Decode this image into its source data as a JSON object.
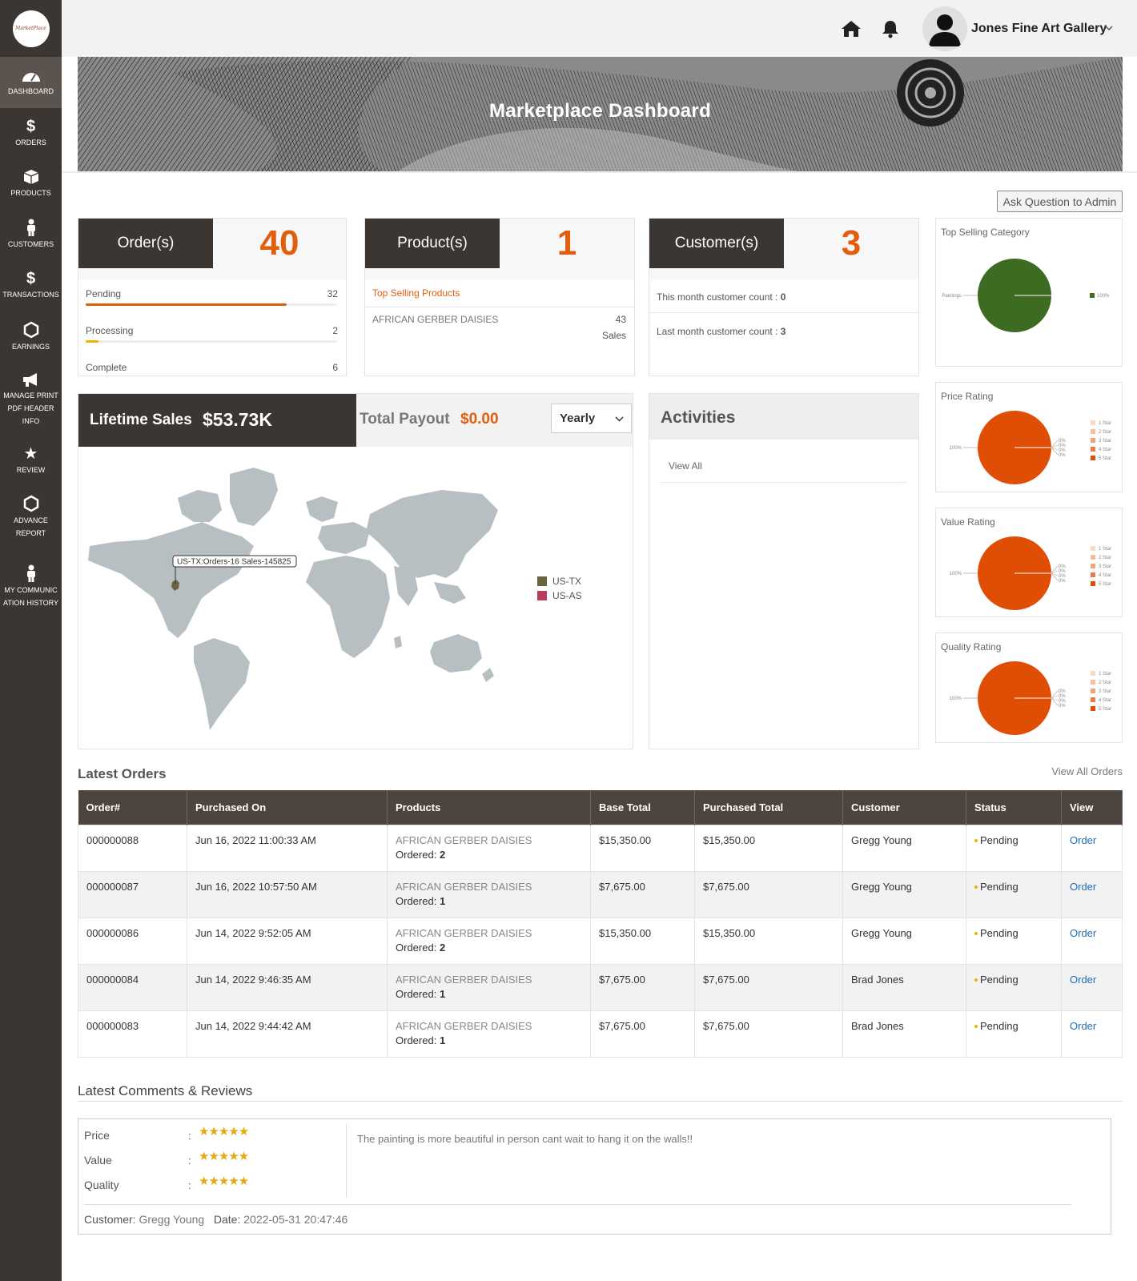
{
  "sidebar": {
    "logo": "MarketPlace",
    "items": [
      {
        "label": "DASHBOARD"
      },
      {
        "label": "ORDERS"
      },
      {
        "label": "PRODUCTS"
      },
      {
        "label": "CUSTOMERS"
      },
      {
        "label": "TRANSACTIONS"
      },
      {
        "label": "EARNINGS"
      },
      {
        "label": "MANAGE PRINT PDF HEADER INFO"
      },
      {
        "label": "REVIEW"
      },
      {
        "label": "ADVANCE REPORT"
      },
      {
        "label": "MY COMMUNICATION HISTORY"
      }
    ]
  },
  "header": {
    "user_name": "Jones Fine Art Gallery",
    "icons": [
      "home-icon",
      "bell-icon",
      "user-avatar-icon",
      "chevron-down-icon"
    ]
  },
  "banner": {
    "title": "Marketplace Dashboard"
  },
  "ask_button": "Ask Question to Admin",
  "orders_card": {
    "title": "Order(s)",
    "count": "40",
    "rows": [
      {
        "label": "Pending",
        "value": "32",
        "fill": 0.8
      },
      {
        "label": "Processing",
        "value": "2",
        "fill": 0.05
      },
      {
        "label": "Complete",
        "value": "6"
      }
    ]
  },
  "products_card": {
    "title": "Product(s)",
    "count": "1",
    "subtitle": "Top Selling Products",
    "product": "AFRICAN GERBER DAISIES",
    "sales_count": "43",
    "sales_label": "Sales"
  },
  "customers_card": {
    "title": "Customer(s)",
    "count": "3",
    "this_month_label": "This month customer count :",
    "this_month_value": "0",
    "last_month_label": "Last month customer count :",
    "last_month_value": "3"
  },
  "chart_data": [
    {
      "type": "pie",
      "title": "Top Selling Category",
      "categories": [
        "Paintings"
      ],
      "values": [
        100
      ],
      "labels": {
        "left": "Paintings",
        "legend": "100%"
      },
      "colors": [
        "#3d6b21"
      ]
    },
    {
      "type": "pie",
      "title": "Price Rating",
      "categories": [
        "1 Star",
        "2 Star",
        "3 Star",
        "4 Star",
        "5 Star"
      ],
      "values": [
        0,
        0,
        0,
        0,
        100
      ],
      "labels": {
        "left": "100%",
        "small": [
          "0%",
          "0%",
          "0%",
          "0%"
        ]
      },
      "colors": [
        "#fbd8c4",
        "#f8bd9b",
        "#f3a277",
        "#ec7a45",
        "#e04e06"
      ]
    },
    {
      "type": "pie",
      "title": "Value Rating",
      "categories": [
        "1 Star",
        "2 Star",
        "3 Star",
        "4 Star",
        "5 Star"
      ],
      "values": [
        0,
        0,
        0,
        0,
        100
      ],
      "labels": {
        "left": "100%",
        "small": [
          "0%",
          "0%",
          "0%",
          "0%"
        ]
      },
      "colors": [
        "#fbd8c4",
        "#f8bd9b",
        "#f3a277",
        "#ec7a45",
        "#e04e06"
      ]
    },
    {
      "type": "pie",
      "title": "Quality Rating",
      "categories": [
        "1 Star",
        "2 Star",
        "3 Star",
        "4 Star",
        "5 Star"
      ],
      "values": [
        0,
        0,
        0,
        0,
        100
      ],
      "labels": {
        "left": "100%",
        "small": [
          "0%",
          "0%",
          "0%",
          "0%"
        ]
      },
      "colors": [
        "#fbd8c4",
        "#f8bd9b",
        "#f3a277",
        "#ec7a45",
        "#e04e06"
      ]
    }
  ],
  "sales": {
    "lifetime_label": "Lifetime Sales",
    "lifetime_value": "$53.73K",
    "payout_label": "Total Payout",
    "payout_value": "$0.00",
    "period": "Yearly",
    "map_tooltip": "US-TX:Orders-16 Sales-145825",
    "map_legend": [
      {
        "label": "US-TX",
        "color": "#6b6440"
      },
      {
        "label": "US-AS",
        "color": "#b73d5c"
      }
    ]
  },
  "activities": {
    "title": "Activities",
    "view_all": "View All"
  },
  "latest_orders": {
    "title": "Latest Orders",
    "view_all": "View All Orders",
    "columns": [
      "Order#",
      "Purchased On",
      "Products",
      "Base Total",
      "Purchased Total",
      "Customer",
      "Status",
      "View"
    ],
    "ordered_label": "Ordered:",
    "rows": [
      {
        "order": "000000088",
        "date": "Jun 16, 2022 11:00:33 AM",
        "product": "AFRICAN GERBER DAISIES",
        "qty": "2",
        "base": "$15,350.00",
        "purchased": "$15,350.00",
        "customer": "Gregg Young",
        "status": "Pending",
        "view": "Order"
      },
      {
        "order": "000000087",
        "date": "Jun 16, 2022 10:57:50 AM",
        "product": "AFRICAN GERBER DAISIES",
        "qty": "1",
        "base": "$7,675.00",
        "purchased": "$7,675.00",
        "customer": "Gregg Young",
        "status": "Pending",
        "view": "Order"
      },
      {
        "order": "000000086",
        "date": "Jun 14, 2022 9:52:05 AM",
        "product": "AFRICAN GERBER DAISIES",
        "qty": "2",
        "base": "$15,350.00",
        "purchased": "$15,350.00",
        "customer": "Gregg Young",
        "status": "Pending",
        "view": "Order"
      },
      {
        "order": "000000084",
        "date": "Jun 14, 2022 9:46:35 AM",
        "product": "AFRICAN GERBER DAISIES",
        "qty": "1",
        "base": "$7,675.00",
        "purchased": "$7,675.00",
        "customer": "Brad Jones",
        "status": "Pending",
        "view": "Order"
      },
      {
        "order": "000000083",
        "date": "Jun 14, 2022 9:44:42 AM",
        "product": "AFRICAN GERBER DAISIES",
        "qty": "1",
        "base": "$7,675.00",
        "purchased": "$7,675.00",
        "customer": "Brad Jones",
        "status": "Pending",
        "view": "Order"
      }
    ]
  },
  "reviews": {
    "title": "Latest Comments & Reviews",
    "ratings": [
      {
        "label": "Price",
        "stars": 5
      },
      {
        "label": "Value",
        "stars": 5
      },
      {
        "label": "Quality",
        "stars": 5
      }
    ],
    "star_glyphs": "★★★★★",
    "separator": ":",
    "comment": "The painting is more beautiful in person cant wait to hang it on the walls!!",
    "customer_label": "Customer:",
    "customer_value": "Gregg Young",
    "date_label": "Date:",
    "date_value": "2022-05-31 20:47:46"
  }
}
